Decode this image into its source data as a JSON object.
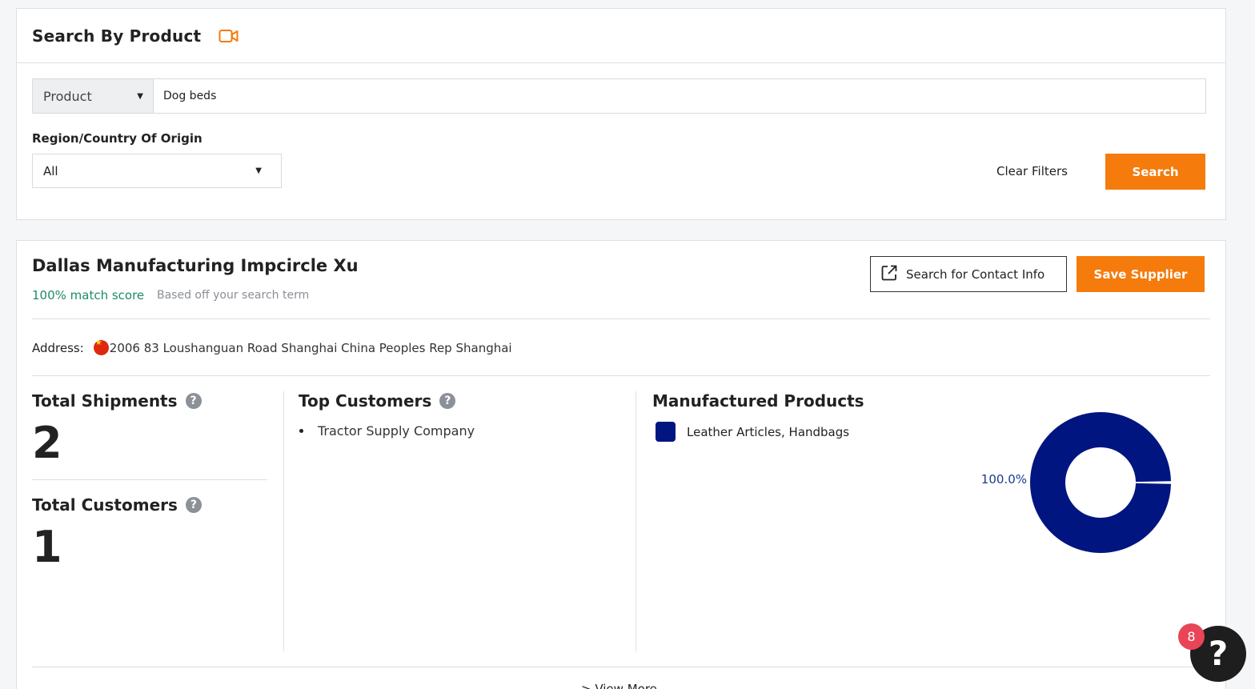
{
  "search": {
    "title": "Search By Product",
    "video_icon": "video-camera-icon",
    "filter_type": "Product",
    "query_value": "Dog beds",
    "region_label": "Region/Country Of Origin",
    "region_value": "All",
    "clear_label": "Clear Filters",
    "search_label": "Search",
    "accent_color": "#f47b0c"
  },
  "supplier": {
    "name": "Dallas Manufacturing Impcircle Xu",
    "match_score": "100% match score",
    "match_note": "Based off your search term",
    "contact_label": "Search for Contact Info",
    "save_label": "Save Supplier",
    "address_label": "Address:",
    "address_value": "2006 83 Loushanguan Road Shanghai China Peoples Rep Shanghai",
    "flag_icon": "china-flag-icon"
  },
  "stats": {
    "shipments_label": "Total Shipments",
    "shipments_value": "2",
    "customers_label": "Total Customers",
    "customers_value": "1",
    "top_customers_label": "Top Customers",
    "top_customers": [
      "Tractor Supply Company"
    ],
    "manufactured_label": "Manufactured Products",
    "view_more": "> View More"
  },
  "chart_data": {
    "type": "pie",
    "categories": [
      "Leather Articles, Handbags"
    ],
    "values": [
      100.0
    ],
    "slice_labels": [
      "100.0%"
    ],
    "colors": [
      "#001580"
    ],
    "legend": "top-left"
  },
  "help": {
    "glyph": "?",
    "badge_count": "8"
  }
}
